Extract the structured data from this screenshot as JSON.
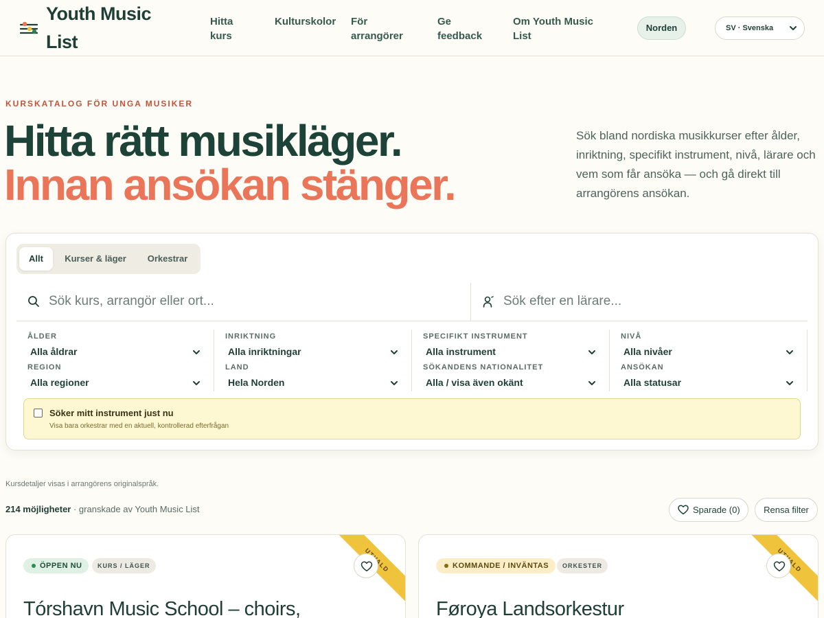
{
  "header": {
    "logo_text": "Youth Music List",
    "nav": [
      "Hitta kurs",
      "Kulturskolor",
      "För arrangörer",
      "Ge feedback",
      "Om Youth Music List"
    ],
    "region_button": "Norden",
    "language_select": "SV · Svenska"
  },
  "hero": {
    "eyebrow": "KURSKATALOG FÖR UNGA MUSIKER",
    "line1": "Hitta rätt musikläger.",
    "line2": "Innan ansökan stänger.",
    "description": "Sök bland nordiska musikkurser efter ålder, inriktning, specifikt instrument, nivå, lärare och vem som får ansöka — och gå direkt till arrangörens ansökan."
  },
  "search": {
    "tabs": [
      "Allt",
      "Kurser & läger",
      "Orkestrar"
    ],
    "active_tab": "Allt",
    "search_placeholder": "Sök kurs, arrangör eller ort...",
    "search_value": "",
    "teacher_placeholder": "Sök efter en lärare...",
    "teacher_value": "",
    "filters": [
      {
        "label": "ÅLDER",
        "value": "Alla åldrar"
      },
      {
        "label": "INRIKTNING",
        "value": "Alla inriktningar"
      },
      {
        "label": "SPECIFIKT INSTRUMENT",
        "value": "Alla instrument"
      },
      {
        "label": "NIVÅ",
        "value": "Alla nivåer"
      },
      {
        "label": "REGION",
        "value": "Alla regioner"
      },
      {
        "label": "LAND",
        "value": "Hela Norden"
      },
      {
        "label": "SÖKANDENS NATIONALITET",
        "value": "Alla / visa även okänt"
      },
      {
        "label": "ANSÖKAN",
        "value": "Alla statusar"
      }
    ],
    "instrument_alert": {
      "title": "Söker mitt instrument just nu",
      "subtitle": "Visa bara orkestrar med en aktuell, kontrollerad efterfrågan",
      "checked": false
    }
  },
  "results": {
    "language_note": "Kursdetaljer visas i arrangörens originalspråk.",
    "count": "214 möjligheter",
    "count_suffix": " · granskade av Youth Music List",
    "saved_label": "Sparade (0)",
    "clear_label": "Rensa filter"
  },
  "cards": [
    {
      "ribbon": "UTVALD",
      "status": "ÖPPEN NU",
      "type": "KURS / LÄGER",
      "title": "Tórshavn Music School – choirs,"
    },
    {
      "ribbon": "UTVALD",
      "status": "KOMMANDE / INVÄNTAS",
      "type": "ORKESTER",
      "title": "Føroya Landsorkestur"
    }
  ],
  "colors": {
    "accent_green": "#1d4238",
    "accent_coral": "#ea7558",
    "ribbon_yellow": "#f0c33c",
    "eyebrow_red": "#c2533a"
  }
}
